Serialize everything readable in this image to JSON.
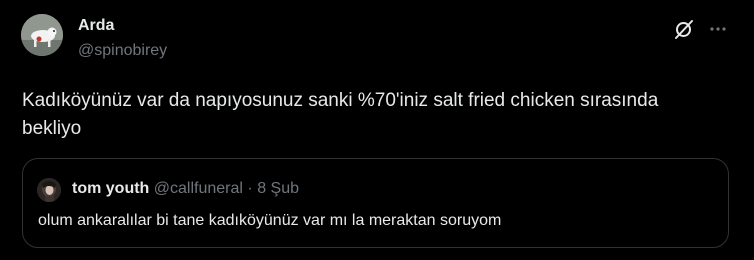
{
  "tweet": {
    "author": {
      "name": "Arda",
      "handle": "@spinobirey"
    },
    "text": "Kadıköyünüz var da napıyosunuz sanki %70'iniz salt fried chicken sırasında bekliyo",
    "actions": {
      "grok_icon": "grok-icon",
      "more_icon": "more-dots-icon"
    }
  },
  "quote": {
    "author": {
      "name": "tom youth",
      "handle": "@callfuneral"
    },
    "separator": "·",
    "date": "8 Şub",
    "text": "olum ankaralılar bi tane kadıköyünüz var mı la meraktan soruyom"
  },
  "colors": {
    "background": "#000000",
    "primary_text": "#e7e9ea",
    "secondary_text": "#71767b",
    "border": "#2f3336"
  }
}
